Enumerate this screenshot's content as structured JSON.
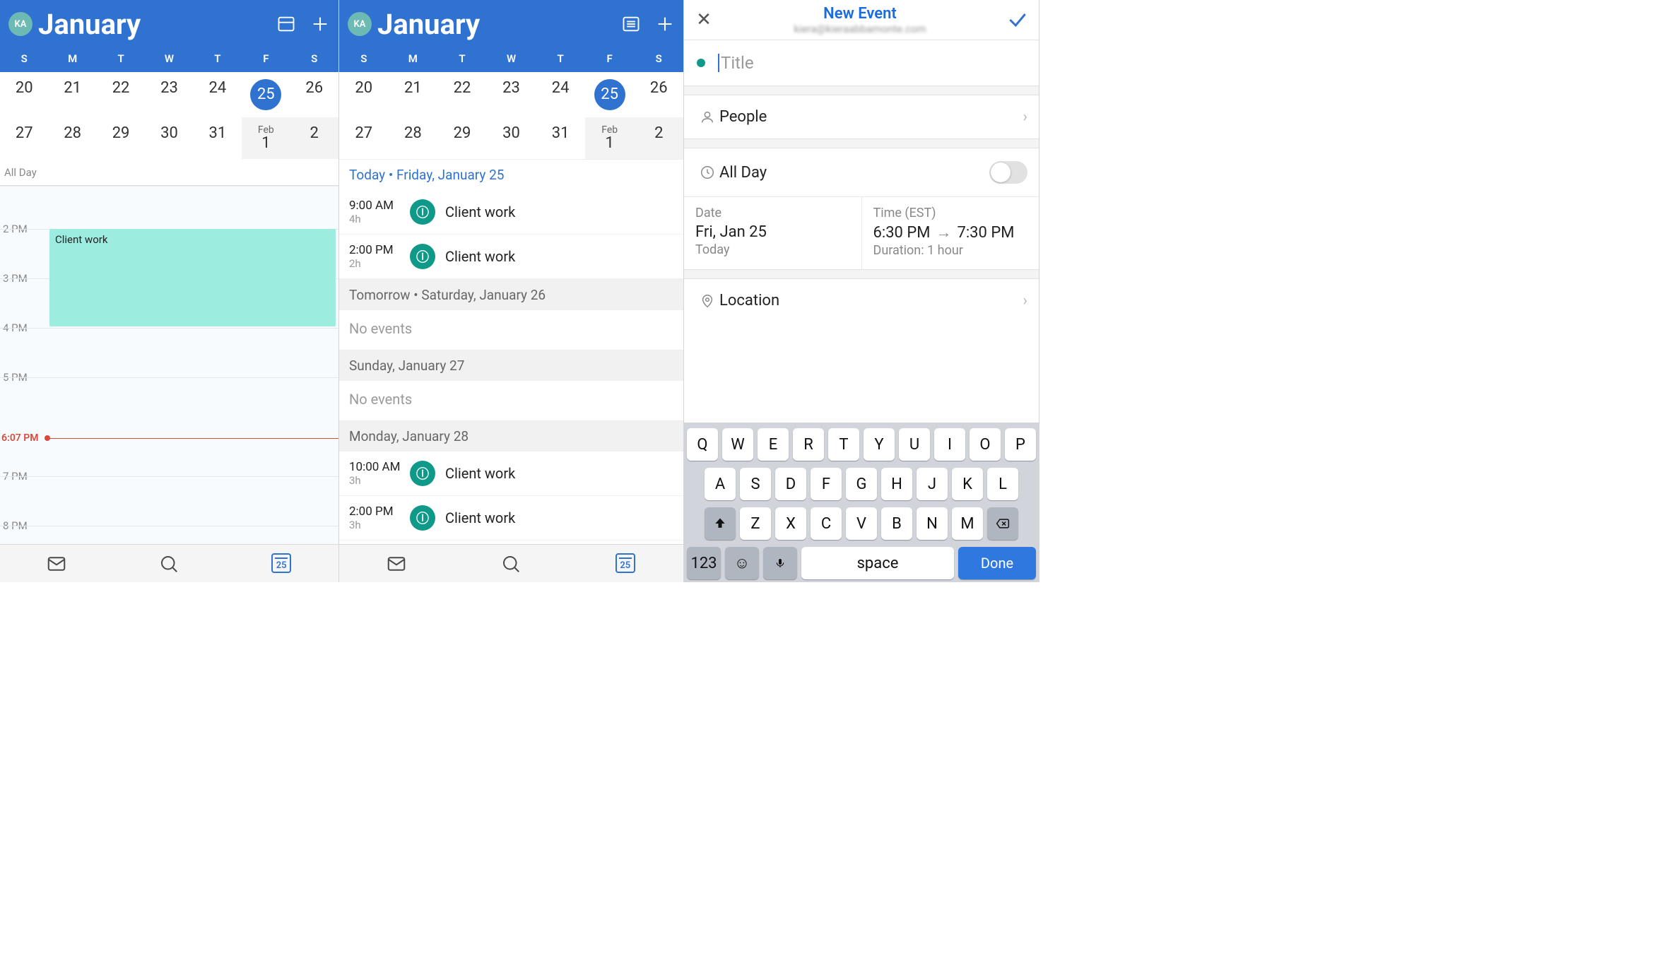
{
  "header": {
    "avatar_initials": "KA",
    "month_title": "January",
    "weekdays": [
      "S",
      "M",
      "T",
      "W",
      "T",
      "F",
      "S"
    ],
    "rows": [
      [
        {
          "num": "20"
        },
        {
          "num": "21"
        },
        {
          "num": "22"
        },
        {
          "num": "23"
        },
        {
          "num": "24"
        },
        {
          "num": "25",
          "selected": true
        },
        {
          "num": "26"
        }
      ],
      [
        {
          "num": "27"
        },
        {
          "num": "28"
        },
        {
          "num": "29"
        },
        {
          "num": "30"
        },
        {
          "num": "31"
        },
        {
          "month": "Feb",
          "num": "1",
          "muted": true
        },
        {
          "num": "2",
          "muted": true
        }
      ]
    ]
  },
  "day_view": {
    "all_day_label": "All Day",
    "hours": [
      "2 PM",
      "3 PM",
      "4 PM",
      "5 PM",
      "7 PM",
      "8 PM"
    ],
    "now_label": "6:07 PM",
    "event_title": "Client work",
    "tab_cal_day": "25"
  },
  "agenda": {
    "today_header": "Today • Friday, January 25",
    "sections": [
      {
        "header": "",
        "items": [
          {
            "time": "9:00 AM",
            "dur": "4h",
            "title": "Client work"
          },
          {
            "time": "2:00 PM",
            "dur": "2h",
            "title": "Client work"
          }
        ]
      },
      {
        "header": "Tomorrow • Saturday, January 26",
        "empty": "No events"
      },
      {
        "header": "Sunday, January 27",
        "empty": "No events"
      },
      {
        "header": "Monday, January 28",
        "items": [
          {
            "time": "10:00 AM",
            "dur": "3h",
            "title": "Client work"
          },
          {
            "time": "2:00 PM",
            "dur": "3h",
            "title": "Client work"
          }
        ]
      }
    ],
    "tab_cal_day": "25"
  },
  "new_event": {
    "title": "New Event",
    "account": "kiera@kieraabbamonte.com",
    "title_placeholder": "Title",
    "people_label": "People",
    "allday_label": "All Day",
    "date_label": "Date",
    "date_value": "Fri, Jan 25",
    "date_sub": "Today",
    "time_label": "Time (EST)",
    "time_start": "6:30 PM",
    "time_end": "7:30 PM",
    "time_sub": "Duration: 1 hour",
    "location_label": "Location"
  },
  "keyboard": {
    "rows": [
      [
        "Q",
        "W",
        "E",
        "R",
        "T",
        "Y",
        "U",
        "I",
        "O",
        "P"
      ],
      [
        "A",
        "S",
        "D",
        "F",
        "G",
        "H",
        "J",
        "K",
        "L"
      ],
      [
        "Z",
        "X",
        "C",
        "V",
        "B",
        "N",
        "M"
      ]
    ],
    "num": "123",
    "space": "space",
    "done": "Done"
  }
}
